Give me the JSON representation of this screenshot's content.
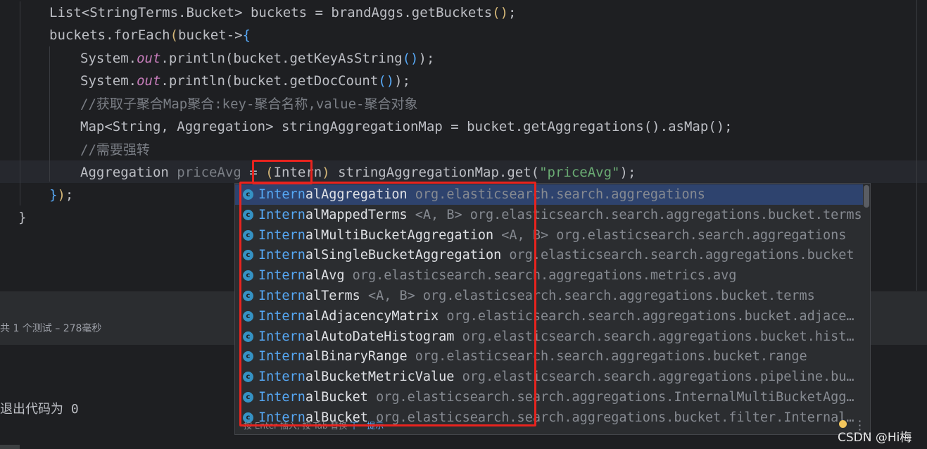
{
  "editor": {
    "lines": [
      {
        "id": "l1",
        "tokens": [
          {
            "t": "List<StringTerms.Bucket> buckets = brandAggs.getBuckets",
            "c": ""
          },
          {
            "t": "()",
            "c": "paren-y"
          },
          {
            "t": ";",
            "c": ""
          }
        ]
      },
      {
        "id": "l2",
        "tokens": [
          {
            "t": "buckets.forEach",
            "c": ""
          },
          {
            "t": "(",
            "c": "paren-y"
          },
          {
            "t": "bucket->",
            "c": ""
          },
          {
            "t": "{",
            "c": "paren-b"
          }
        ]
      },
      {
        "id": "l3",
        "tokens": [
          {
            "t": "System.",
            "c": ""
          },
          {
            "t": "out",
            "c": "static"
          },
          {
            "t": ".println",
            "c": ""
          },
          {
            "t": "(",
            "c": "paren-g"
          },
          {
            "t": "bucket.getKeyAsString",
            "c": ""
          },
          {
            "t": "()",
            "c": "paren-b"
          },
          {
            "t": ")",
            "c": "paren-g"
          },
          {
            "t": ";",
            "c": ""
          }
        ]
      },
      {
        "id": "l4",
        "tokens": [
          {
            "t": "System.",
            "c": ""
          },
          {
            "t": "out",
            "c": "static"
          },
          {
            "t": ".println",
            "c": ""
          },
          {
            "t": "(",
            "c": "paren-g"
          },
          {
            "t": "bucket.getDocCount",
            "c": ""
          },
          {
            "t": "()",
            "c": "paren-b"
          },
          {
            "t": ")",
            "c": "paren-g"
          },
          {
            "t": ";",
            "c": ""
          }
        ]
      },
      {
        "id": "l5",
        "tokens": [
          {
            "t": "//获取子聚合Map聚合:key-聚合名称,value-聚合对象",
            "c": "comment"
          }
        ]
      },
      {
        "id": "l6",
        "tokens": [
          {
            "t": "Map<String, Aggregation> stringAggregationMap = bucket.getAggregations",
            "c": ""
          },
          {
            "t": "()",
            "c": "paren-g"
          },
          {
            "t": ".asMap",
            "c": ""
          },
          {
            "t": "()",
            "c": "paren-g"
          },
          {
            "t": ";",
            "c": ""
          }
        ]
      },
      {
        "id": "l7",
        "tokens": [
          {
            "t": "//需要强转",
            "c": "comment"
          }
        ]
      },
      {
        "id": "l8",
        "tokens": [
          {
            "t": "Aggregation ",
            "c": ""
          },
          {
            "t": "priceAvg",
            "c": "param"
          },
          {
            "t": " = ",
            "c": ""
          },
          {
            "t": "(",
            "c": "paren-y"
          },
          {
            "t": "Intern",
            "c": ""
          },
          {
            "t": ")",
            "c": "paren-y"
          },
          {
            "t": " stringAggregationMap.get",
            "c": ""
          },
          {
            "t": "(",
            "c": "paren-g"
          },
          {
            "t": "\"priceAvg\"",
            "c": "str"
          },
          {
            "t": ")",
            "c": "paren-g"
          },
          {
            "t": ";",
            "c": ""
          }
        ]
      },
      {
        "id": "l9",
        "tokens": [
          {
            "t": "}",
            "c": "paren-b"
          },
          {
            "t": ")",
            "c": "paren-y"
          },
          {
            "t": ";",
            "c": ""
          }
        ]
      },
      {
        "id": "l10",
        "tokens": [
          {
            "t": "}",
            "c": ""
          }
        ]
      }
    ]
  },
  "test_bar": {
    "summary": "共 1 个测试 – 278毫秒"
  },
  "console": {
    "exit_line": "退出代码为 0"
  },
  "completion": {
    "typed_prefix": "Intern",
    "items": [
      {
        "match": "Intern",
        "rest": "alAggregation",
        "generics": "",
        "pkg": "org.elasticsearch.search.aggregations",
        "selected": true
      },
      {
        "match": "Intern",
        "rest": "alMappedTerms",
        "generics": "<A, B>",
        "pkg": "org.elasticsearch.search.aggregations.bucket.terms",
        "selected": false
      },
      {
        "match": "Intern",
        "rest": "alMultiBucketAggregation",
        "generics": "<A, B>",
        "pkg": "org.elasticsearch.search.aggregations",
        "selected": false
      },
      {
        "match": "Intern",
        "rest": "alSingleBucketAggregation",
        "generics": "",
        "pkg": "org.elasticsearch.search.aggregations.bucket",
        "selected": false
      },
      {
        "match": "Intern",
        "rest": "alAvg",
        "generics": "",
        "pkg": "org.elasticsearch.search.aggregations.metrics.avg",
        "selected": false
      },
      {
        "match": "Intern",
        "rest": "alTerms",
        "generics": "<A, B>",
        "pkg": "org.elasticsearch.search.aggregations.bucket.terms",
        "selected": false
      },
      {
        "match": "Intern",
        "rest": "alAdjacencyMatrix",
        "generics": "",
        "pkg": "org.elasticsearch.search.aggregations.bucket.adjace…",
        "selected": false
      },
      {
        "match": "Intern",
        "rest": "alAutoDateHistogram",
        "generics": "",
        "pkg": "org.elasticsearch.search.aggregations.bucket.hist…",
        "selected": false
      },
      {
        "match": "Intern",
        "rest": "alBinaryRange",
        "generics": "",
        "pkg": "org.elasticsearch.search.aggregations.bucket.range",
        "selected": false
      },
      {
        "match": "Intern",
        "rest": "alBucketMetricValue",
        "generics": "",
        "pkg": "org.elasticsearch.search.aggregations.pipeline.bu…",
        "selected": false
      },
      {
        "match": "Intern",
        "rest": "alBucket",
        "generics": "",
        "pkg": "org.elasticsearch.search.aggregations.InternalMultiBucketAgg…",
        "selected": false
      },
      {
        "match": "Intern",
        "rest": "alBucket",
        "generics": "",
        "pkg": "org.elasticsearch.search.aggregations.bucket.filter.Internal…",
        "selected": false
      }
    ],
    "icon_letter": "c",
    "footer_hint": "按 Enter 插入, 按 Tab 替换",
    "footer_link": "下一提示"
  },
  "watermark": "CSDN @Hi梅",
  "colors": {
    "accent": "#56a8f5",
    "annotation": "#e8231e",
    "selection": "#2e436e"
  }
}
